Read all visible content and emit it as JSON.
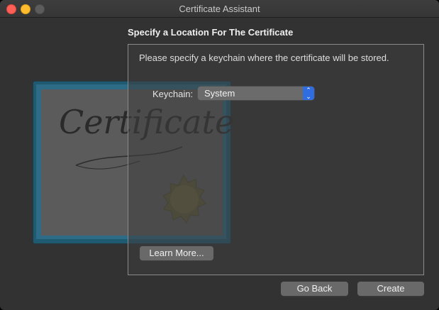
{
  "window": {
    "title": "Certificate Assistant"
  },
  "content": {
    "heading": "Specify a Location For The Certificate",
    "instructions": "Please specify a keychain where the certificate will be stored.",
    "keychain_label": "Keychain:",
    "keychain_value": "System"
  },
  "illustration": {
    "word": "Certificate"
  },
  "buttons": {
    "learn_more": "Learn More...",
    "go_back": "Go Back",
    "create": "Create"
  },
  "colors": {
    "window_bg": "#323232",
    "accent": "#2f6de1",
    "close": "#fe5f57",
    "minimize": "#febc2e"
  }
}
